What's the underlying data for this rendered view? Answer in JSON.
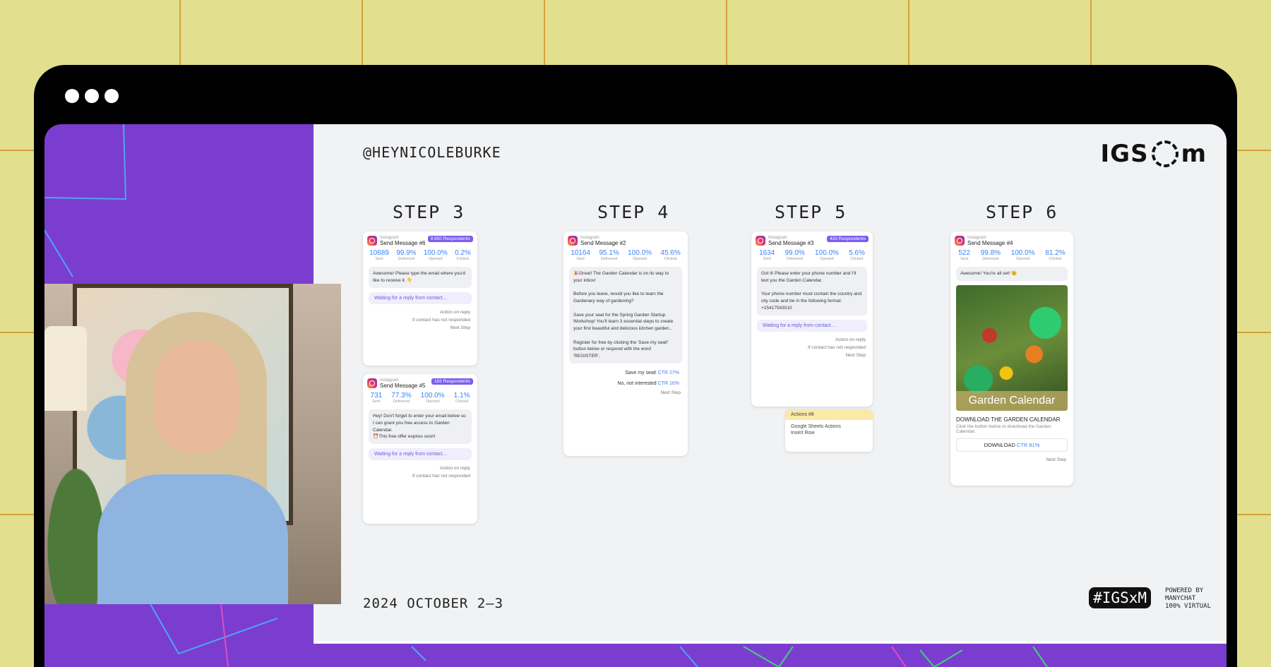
{
  "slide": {
    "handle": "@HEYNICOLEBURKE",
    "logo": "IGS",
    "logo_suffix": "m",
    "date": "2024 OCTOBER 2–3",
    "hashtag": "#IGSxM",
    "powered_lines": [
      "POWERED BY",
      "MANYCHAT",
      "100% VIRTUAL"
    ]
  },
  "steps": [
    {
      "title": "STEP 3"
    },
    {
      "title": "STEP 4"
    },
    {
      "title": "STEP 5"
    },
    {
      "title": "STEP 6"
    }
  ],
  "stat_labels": [
    "Sent",
    "Delivered",
    "Opened",
    "Clicked"
  ],
  "cards": {
    "c6": {
      "channel": "Instagram",
      "title": "Send Message #6",
      "badge": "9,950 Respondents",
      "stats": [
        "10689",
        "99.9%",
        "100.0%",
        "0.2%"
      ],
      "message": "Awesome! Please type the email where you'd like to receive it. 👇",
      "waiting": "Waiting for a reply from contact...",
      "action": "Action on reply",
      "no_response": "If contact has not responded",
      "next": "Next Step"
    },
    "c5": {
      "channel": "Instagram",
      "title": "Send Message #5",
      "badge": "193 Respondents",
      "stats": [
        "731",
        "77.3%",
        "100.0%",
        "1.1%"
      ],
      "message": "Hey! Don't forget to enter your email below so I can grant you free access to Garden Calendar.\n⏰This free offer expires soon!",
      "waiting": "Waiting for a reply from contact...",
      "action": "Action on reply",
      "no_response": "If contact has not responded"
    },
    "c2": {
      "channel": "Instagram",
      "title": "Send Message #2",
      "stats": [
        "10164",
        "95.1%",
        "100.0%",
        "45.6%"
      ],
      "message": "🎉Great! The Garden Calendar is on its way to your inbox!\n\nBefore you leave, would you like to learn the Gardenary way of gardening?\n\nSave your seat for the Spring Garden Startup Workshop! You'll learn 3 essential steps to create your first beautiful and delicious kitchen garden..\n\nRegister for free by clicking the 'Save my seat!' button below or respond with the word 'REGISTER'.",
      "btn1": "Save my seat!",
      "btn1_ctr": "CTR 27%",
      "btn2": "No, not interested",
      "btn2_ctr": "CTR 16%",
      "next": "Next Step"
    },
    "c3": {
      "channel": "Instagram",
      "title": "Send Message #3",
      "badge": "433 Respondents",
      "stats": [
        "1634",
        "99.0%",
        "100.0%",
        "5.6%"
      ],
      "message": "Got it! Please enter your phone number and I'll text you the Garden Calendar.\n\nYour phone number must contain the country and city code and be in the following format: +15417543010",
      "waiting": "Waiting for a reply from contact...",
      "action": "Action on reply",
      "no_response": "If contact has not responded",
      "next": "Next Step"
    },
    "actions": {
      "title": "Actions #8",
      "line1": "Google Sheets Actions",
      "line2": "Insert Row"
    },
    "c4": {
      "channel": "Instagram",
      "title": "Send Message #4",
      "stats": [
        "522",
        "99.8%",
        "100.0%",
        "81.2%"
      ],
      "message": "Awesome! You're all set! 😉",
      "image_label": "Garden Calendar",
      "dl_title": "DOWNLOAD THE GARDEN CALENDAR",
      "dl_text": "Click the button below to download the Garden Calendar.",
      "dl_btn": "DOWNLOAD",
      "dl_ctr": "CTR 81%",
      "next": "Next Step"
    }
  },
  "colors": {
    "background": "#e2e08f",
    "grid": "#d4a13a",
    "purple": "#7b3dd0",
    "accent": "#3b82f6"
  }
}
